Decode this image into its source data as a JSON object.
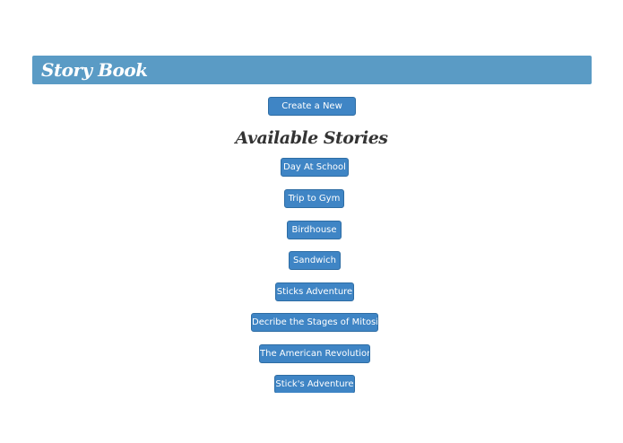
{
  "header": {
    "title": "Story Book"
  },
  "actions": {
    "create_label": "Create a New Story"
  },
  "stories": {
    "heading": "Available Stories",
    "items": [
      {
        "label": "Day At School"
      },
      {
        "label": "Trip to Gym"
      },
      {
        "label": "Birdhouse"
      },
      {
        "label": "Sandwich"
      },
      {
        "label": "Sticks Adventure"
      },
      {
        "label": "Decribe the Stages of Mitosis"
      },
      {
        "label": "The American Revolution"
      },
      {
        "label": "Stick's Adventure"
      }
    ]
  },
  "colors": {
    "header_bg": "#5a9bc5",
    "button_bg": "#3f85c5",
    "button_border": "#2e6da4",
    "heading_text": "#333333"
  }
}
